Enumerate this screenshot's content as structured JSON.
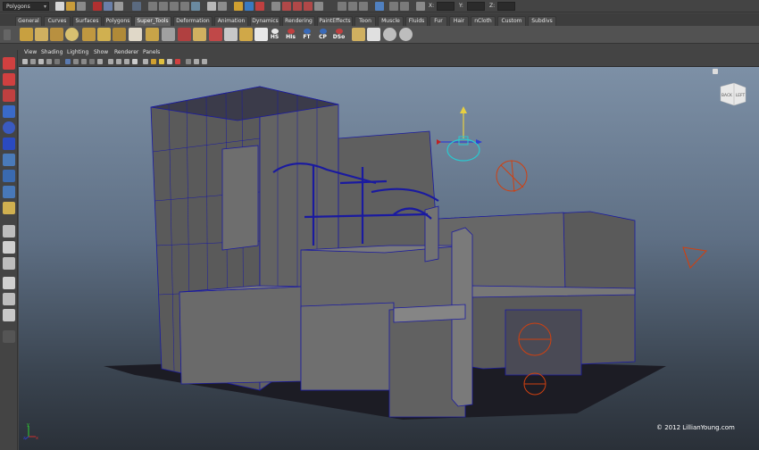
{
  "status_line": {
    "mode": "Polygons",
    "x_label": "X:",
    "y_label": "Y:",
    "z_label": "Z:",
    "x_value": "",
    "y_value": "",
    "z_value": ""
  },
  "shelf_tabs": [
    {
      "label": "General",
      "active": false
    },
    {
      "label": "Curves",
      "active": false
    },
    {
      "label": "Surfaces",
      "active": false
    },
    {
      "label": "Polygons",
      "active": false
    },
    {
      "label": "Super_Tools",
      "active": true
    },
    {
      "label": "Deformation",
      "active": false
    },
    {
      "label": "Animation",
      "active": false
    },
    {
      "label": "Dynamics",
      "active": false
    },
    {
      "label": "Rendering",
      "active": false
    },
    {
      "label": "PaintEffects",
      "active": false
    },
    {
      "label": "Toon",
      "active": false
    },
    {
      "label": "Muscle",
      "active": false
    },
    {
      "label": "Fluids",
      "active": false
    },
    {
      "label": "Fur",
      "active": false
    },
    {
      "label": "Hair",
      "active": false
    },
    {
      "label": "nCloth",
      "active": false
    },
    {
      "label": "Custom",
      "active": false
    },
    {
      "label": "Subdivs",
      "active": false
    }
  ],
  "shelf_text_buttons": [
    "HS",
    "HIs",
    "FT",
    "CP",
    "DSo"
  ],
  "panel_menu": [
    "View",
    "Shading",
    "Lighting",
    "Show",
    "Renderer",
    "Panels"
  ],
  "viewcube": {
    "face_back": "BACK",
    "face_left": "LEFT"
  },
  "viewport": {
    "copyright": "© 2012 LillianYoung.com",
    "axis_y": "y",
    "axis_x": "x",
    "axis_z": "z"
  },
  "colors": {
    "wire": "#1a1aa0",
    "wall": "#5d5d5d",
    "wall_light": "#6a6a6a",
    "accent_orange": "#d04010",
    "manipulator_cyan": "#29c9d0"
  }
}
